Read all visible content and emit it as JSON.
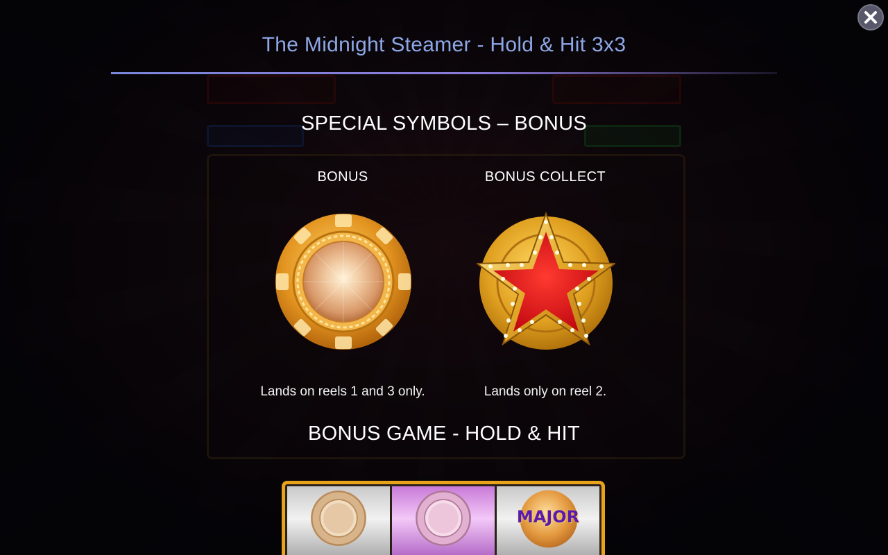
{
  "header": {
    "title": "The Midnight Steamer - Hold & Hit 3x3",
    "close_icon": "close-icon"
  },
  "special_symbols": {
    "heading": "SPECIAL SYMBOLS – BONUS",
    "symbols": [
      {
        "label": "BONUS",
        "icon": "gold-chip-icon",
        "description": "Lands on reels 1 and 3 only."
      },
      {
        "label": "BONUS COLLECT",
        "icon": "red-star-coin-icon",
        "description": "Lands only on reel 2."
      }
    ]
  },
  "bonus_game": {
    "heading": "BONUS GAME - HOLD & HIT",
    "grid_cells": [
      {
        "icon": "chip-icon"
      },
      {
        "icon": "chip-icon"
      },
      {
        "icon": "major-coin-icon",
        "text": "MAJOR"
      }
    ]
  },
  "colors": {
    "title": "#8ea7e6",
    "accent_gold": "#e8a21c",
    "star_red": "#d8101a"
  }
}
